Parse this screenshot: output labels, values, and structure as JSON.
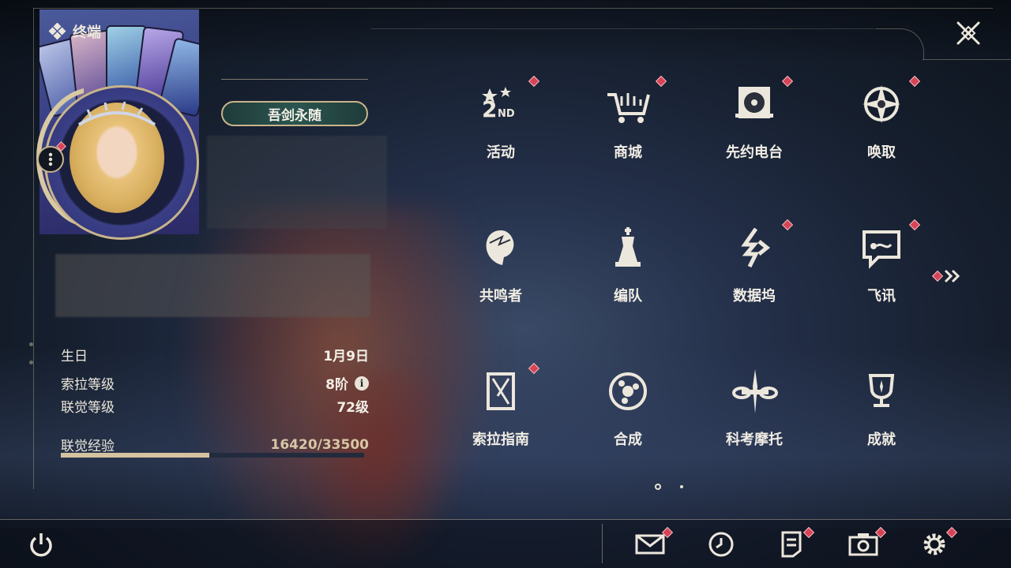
{
  "header": {
    "title": "终端"
  },
  "profile": {
    "name_badge": "吾剑永随"
  },
  "stats": {
    "birthday_label": "生日",
    "birthday_value": "1月9日",
    "sola_level_label": "索拉等级",
    "sola_level_value": "8阶",
    "union_level_label": "联觉等级",
    "union_level_value": "72级",
    "exp_label": "联觉经验",
    "exp_value": "16420/33500",
    "exp_fraction": 0.49
  },
  "grid": [
    {
      "label": "活动",
      "icon": "event-2nd-icon",
      "dot": true
    },
    {
      "label": "商城",
      "icon": "shop-cart-icon",
      "dot": true
    },
    {
      "label": "先约电台",
      "icon": "radio-icon",
      "dot": true
    },
    {
      "label": "唤取",
      "icon": "summon-compass-icon",
      "dot": true
    },
    {
      "label": "共鸣者",
      "icon": "resonator-head-icon",
      "dot": false
    },
    {
      "label": "编队",
      "icon": "chess-team-icon",
      "dot": false
    },
    {
      "label": "数据坞",
      "icon": "data-dock-icon",
      "dot": true
    },
    {
      "label": "飞讯",
      "icon": "message-chat-icon",
      "dot": true
    },
    {
      "label": "索拉指南",
      "icon": "guide-book-icon",
      "dot": true
    },
    {
      "label": "合成",
      "icon": "synthesis-icon",
      "dot": false
    },
    {
      "label": "科考摩托",
      "icon": "motorbike-icon",
      "dot": false
    },
    {
      "label": "成就",
      "icon": "trophy-icon",
      "dot": false
    }
  ],
  "pagination": {
    "current": 1,
    "total": 2
  },
  "bottom_bar": {
    "icons": [
      "power-icon",
      "mail-icon",
      "clock-icon",
      "notes-icon",
      "camera-icon",
      "settings-gear-icon"
    ]
  },
  "colors": {
    "accent_gold": "#c8b48a",
    "notification_red": "#d64455",
    "badge_teal": "#2b5550"
  }
}
